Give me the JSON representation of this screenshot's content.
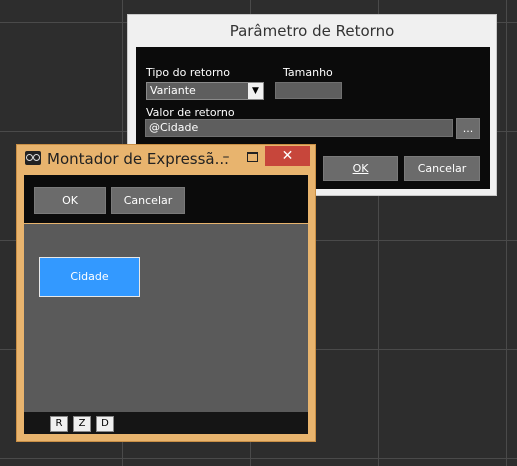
{
  "param_dialog": {
    "title": "Parâmetro de Retorno",
    "tipo_label": "Tipo do retorno",
    "tipo_value": "Variante",
    "tamanho_label": "Tamanho",
    "tamanho_value": "",
    "valor_label": "Valor de retorno",
    "valor_value": "@Cidade",
    "browse_label": "...",
    "ok_label": "OK",
    "cancel_label": "Cancelar"
  },
  "montador": {
    "title": "Montador de Expressã...",
    "min_label": "–",
    "close_label": "✕",
    "ok_label": "OK",
    "cancel_label": "Cancelar",
    "block_label": "Cidade",
    "footer_buttons": [
      "R",
      "Z",
      "D"
    ]
  },
  "colors": {
    "window_frame": "#e8b46e",
    "close_button": "#c7463b",
    "block_fill": "#3399ff",
    "canvas": "#5a5a5a"
  }
}
